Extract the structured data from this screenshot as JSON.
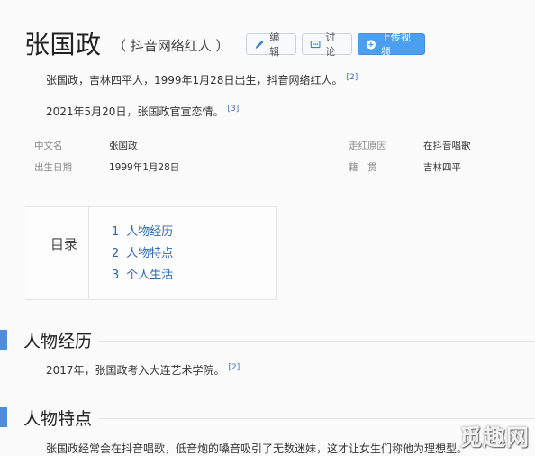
{
  "header": {
    "title": "张国政",
    "subtitle": "（ 抖音网络红人 ）",
    "edit_label": "编辑",
    "discuss_label": "讨论",
    "upload_label": "上传视频"
  },
  "intro": {
    "line1": "张国政，吉林四平人，1999年1月28日出生，抖音网络红人。",
    "line1_ref": "[2]",
    "line2": "2021年5月20日，张国政官宣恋情。",
    "line2_ref": "[3]"
  },
  "infobox": {
    "rows": [
      {
        "label1": "中文名",
        "value1": "张国政",
        "label2": "走红原因",
        "value2": "在抖音唱歌"
      },
      {
        "label1": "出生日期",
        "value1": "1999年1月28日",
        "label2": "籍　贯",
        "value2": "吉林四平"
      }
    ]
  },
  "toc": {
    "title": "目录",
    "items": [
      {
        "num": "1",
        "label": "人物经历"
      },
      {
        "num": "2",
        "label": "人物特点"
      },
      {
        "num": "3",
        "label": "个人生活"
      }
    ]
  },
  "sections": {
    "s1": {
      "title": "人物经历",
      "text": "2017年，张国政考入大连艺术学院。",
      "ref": "[2]"
    },
    "s2": {
      "title": "人物特点",
      "text": "张国政经常会在抖音唱歌，低音炮的嗓音吸引了无数迷妹，这才让女生们称他为理想型。"
    }
  },
  "watermark": "觅趣网",
  "colors": {
    "accent": "#4d8ddc",
    "link": "#3066b0",
    "primary_button": "#4aa0ee"
  }
}
